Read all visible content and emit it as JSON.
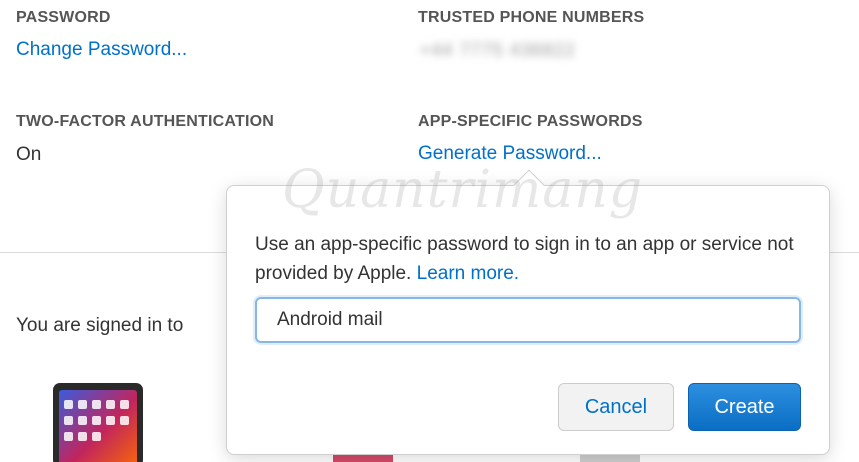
{
  "password": {
    "label": "PASSWORD",
    "link": "Change Password..."
  },
  "trusted_phone": {
    "label": "TRUSTED PHONE NUMBERS",
    "value": "+44 7775 436822"
  },
  "two_factor": {
    "label": "TWO-FACTOR AUTHENTICATION",
    "value": "On"
  },
  "app_passwords": {
    "label": "APP-SPECIFIC PASSWORDS",
    "link": "Generate Password..."
  },
  "devices": {
    "signed_in_text": "You are signed in to"
  },
  "popover": {
    "message": "Use an app-specific password to sign in to an app or service not provided by Apple.",
    "learn_more": "Learn more.",
    "input_value": "Android mail",
    "cancel_label": "Cancel",
    "create_label": "Create"
  },
  "watermark": {
    "text": "Quantrimang"
  },
  "colors": {
    "link": "#0070c9",
    "primary_button": "#0a6ec4",
    "label": "#555555"
  }
}
